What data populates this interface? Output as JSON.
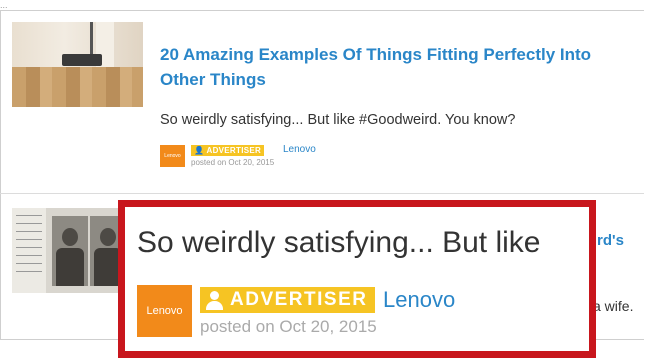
{
  "top_text": "...",
  "article1": {
    "title": "20 Amazing Examples Of Things Fitting Perfectly Into Other Things",
    "description": "So weirdly satisfying... But like #Goodweird. You know?",
    "logo_text": "Lenovo",
    "badge": "ADVERTISER",
    "brand": "Lenovo",
    "posted": "posted on Oct 20, 2015"
  },
  "article2": {
    "title_peek": "rd's",
    "description_peek": "a wife."
  },
  "zoom": {
    "description": "So weirdly satisfying... But like",
    "logo_text": "Lenovo",
    "badge": "ADVERTISER",
    "brand": "Lenovo",
    "posted": "posted on Oct 20, 2015",
    "border_color": "#c8161d"
  },
  "colors": {
    "link": "#2a86c8",
    "badge": "#f6c423",
    "logo": "#f28a1a"
  }
}
